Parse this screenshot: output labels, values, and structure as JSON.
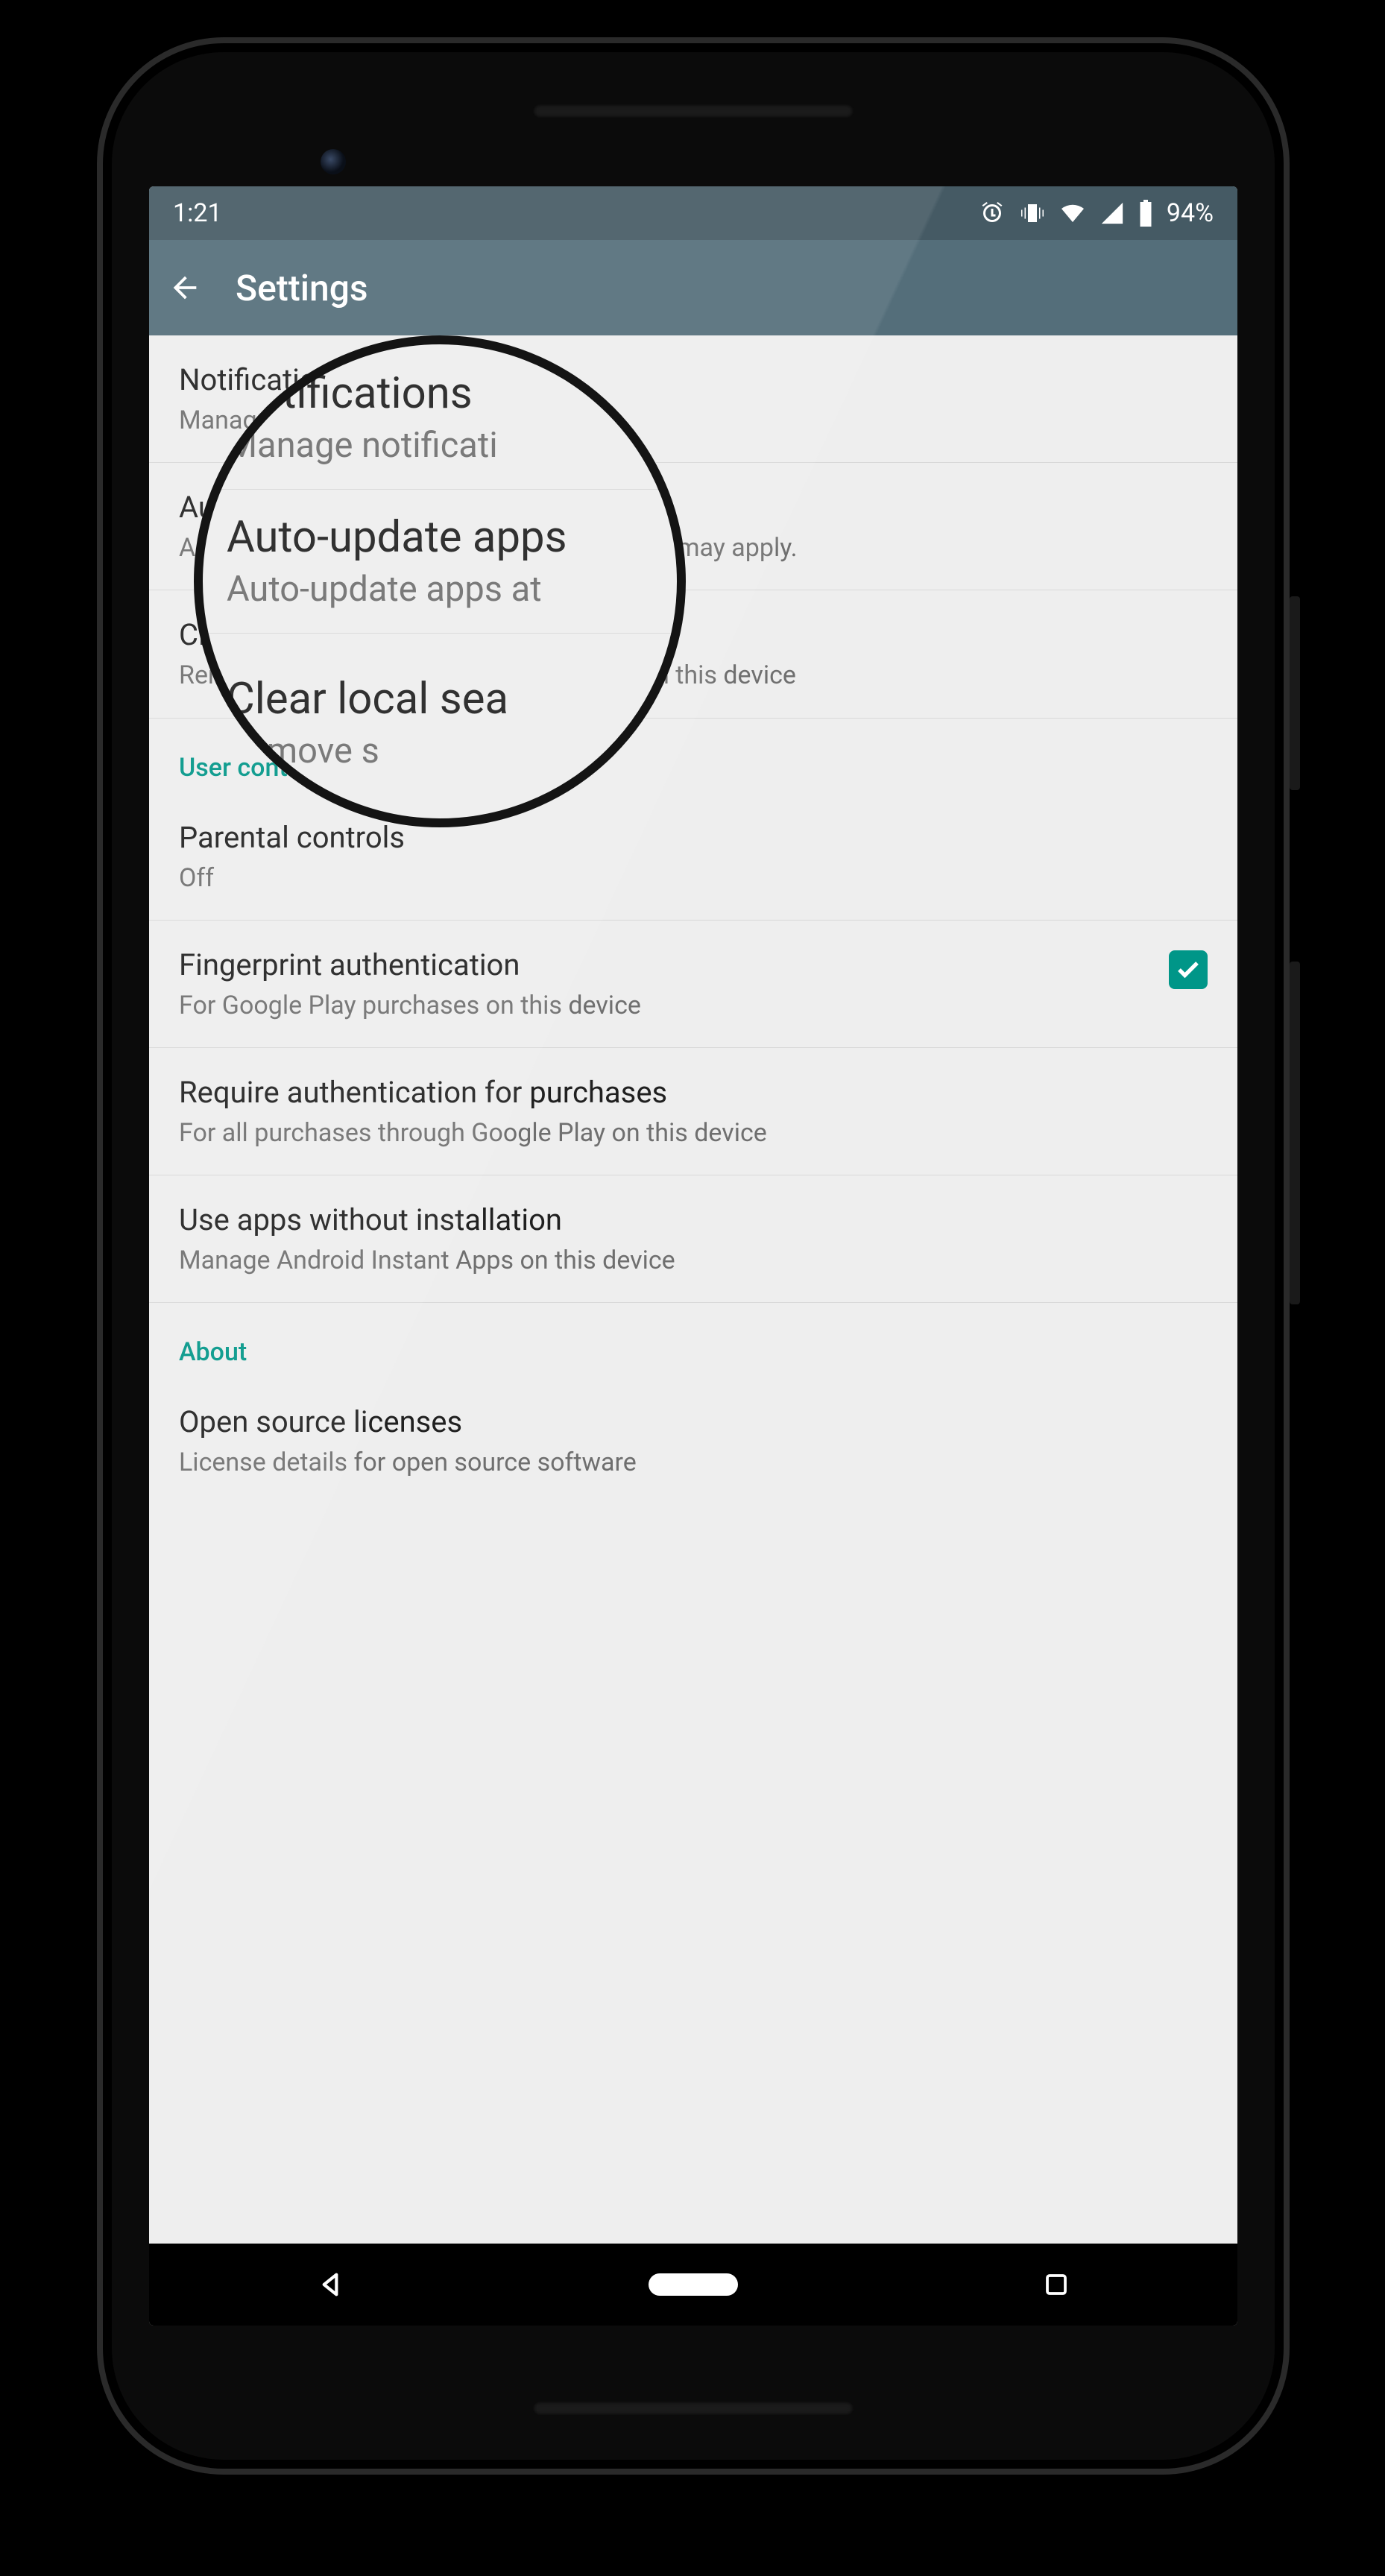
{
  "status": {
    "time": "1:21",
    "battery": "94%"
  },
  "appbar": {
    "title": "Settings"
  },
  "items": {
    "notifications": {
      "title": "Notifications",
      "sub": "Manage notification settings"
    },
    "autoupdate": {
      "title": "Auto-update apps",
      "sub": "Auto-update apps at any time. Data charges may apply."
    },
    "clearsearch": {
      "title": "Clear local search history",
      "sub": "Remove searches you have performed from this device"
    },
    "parental": {
      "title": "Parental controls",
      "sub": "Off"
    },
    "fingerprint": {
      "title": "Fingerprint authentication",
      "sub": "For Google Play purchases on this device"
    },
    "reqauth": {
      "title": "Require authentication for purchases",
      "sub": "For all purchases through Google Play on this device"
    },
    "instant": {
      "title": "Use apps without installation",
      "sub": "Manage Android Instant Apps on this device"
    },
    "licenses": {
      "title": "Open source licenses",
      "sub": "License details for open source software"
    }
  },
  "sections": {
    "user": "User controls",
    "about": "About"
  },
  "lens": {
    "notifications": {
      "title": "Notifications",
      "sub": "Manage notificati"
    },
    "autoupdate": {
      "title": "Auto-update apps",
      "sub": "Auto-update apps at"
    },
    "clearsearch": {
      "title": "Clear local sea",
      "sub": "Remove s"
    }
  },
  "colors": {
    "accent": "#009688",
    "header": "#546e7a",
    "statusbar": "#455a64"
  }
}
